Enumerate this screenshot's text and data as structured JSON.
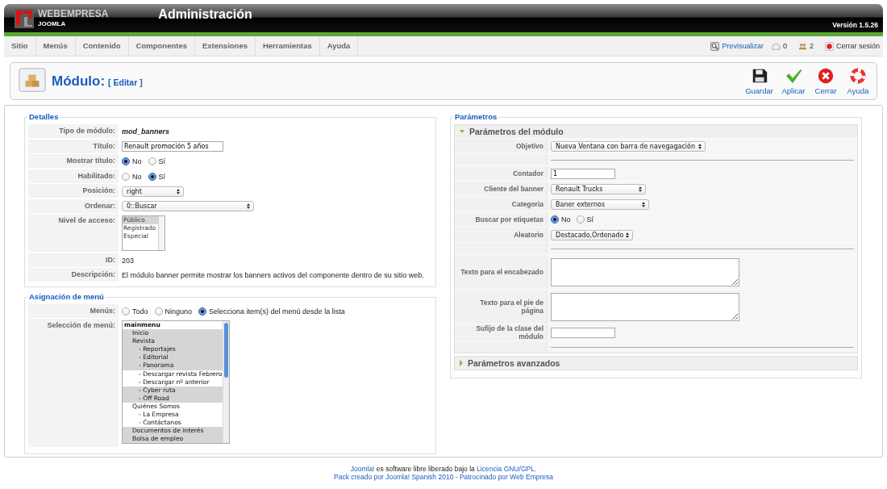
{
  "header": {
    "logo_top": "WEBEMPRESA",
    "logo_bottom": "JOOMLA",
    "title": "Administración",
    "version": "Versión 1.5.26"
  },
  "menu": [
    "Sitio",
    "Menús",
    "Contenido",
    "Componentes",
    "Extensiones",
    "Herramientas",
    "Ayuda"
  ],
  "status": {
    "preview": "Previsualizar",
    "messages": "0",
    "users": "2",
    "logout": "Cerrar sesión"
  },
  "toolbar": {
    "title": "Módulo:",
    "subtitle": "[ Editar ]",
    "buttons": [
      {
        "label": "Guardar",
        "kind": "save"
      },
      {
        "label": "Aplicar",
        "kind": "apply"
      },
      {
        "label": "Cerrar",
        "kind": "close"
      },
      {
        "label": "Ayuda",
        "kind": "help"
      }
    ]
  },
  "details": {
    "legend": "Detalles",
    "rows": [
      {
        "kind": "text",
        "label": "Tipo de módulo:",
        "value": "mod_banners",
        "emphasis": true
      },
      {
        "kind": "input",
        "label": "Título:",
        "value": "Renault promoción 5 años"
      },
      {
        "kind": "radio",
        "label": "Mostrar título:",
        "options": [
          {
            "label": "No",
            "selected": true
          },
          {
            "label": "Sí",
            "selected": false
          }
        ]
      },
      {
        "kind": "radio",
        "label": "Habilitado:",
        "options": [
          {
            "label": "No",
            "selected": false
          },
          {
            "label": "Sí",
            "selected": true
          }
        ]
      },
      {
        "kind": "select",
        "label": "Posición:",
        "value": "right"
      },
      {
        "kind": "select",
        "label": "Ordenar:",
        "value": "0::Buscar"
      },
      {
        "kind": "listbox",
        "label": "Nivel de acceso:",
        "options": [
          {
            "label": "Público",
            "selected": true
          },
          {
            "label": "Registrado",
            "selected": false
          },
          {
            "label": "Especial",
            "selected": false
          }
        ]
      },
      {
        "kind": "text",
        "label": "ID:",
        "value": "203",
        "emphasis": false
      },
      {
        "kind": "text",
        "label": "Descripción:",
        "value": "El módulo banner permite mostrar los banners activos del componente dentro de su sitio web.",
        "emphasis": false
      }
    ]
  },
  "menu_assignment": {
    "legend": "Asignación de menú",
    "menus": {
      "label": "Menús:",
      "options": [
        {
          "label": "Todo",
          "selected": false
        },
        {
          "label": "Ninguno",
          "selected": false
        },
        {
          "label": "Selecciona item(s) del menú desde la lista",
          "selected": true
        }
      ]
    },
    "selection": {
      "label": "Selección de menú:",
      "items": [
        {
          "label": "mainmenu",
          "selected": false,
          "children": [
            {
              "label": "Inicio",
              "selected": true
            },
            {
              "label": "Revista",
              "selected": true,
              "children": [
                {
                  "label": "- Reportajes",
                  "selected": true
                },
                {
                  "label": "- Editorial",
                  "selected": true
                },
                {
                  "label": "- Panorama",
                  "selected": true
                },
                {
                  "label": "- Descargar revista Febrero",
                  "selected": false
                },
                {
                  "label": "- Descargar nº anterior",
                  "selected": false
                },
                {
                  "label": "- Cyber ruta",
                  "selected": true
                },
                {
                  "label": "- Off Road",
                  "selected": true
                }
              ]
            },
            {
              "label": "Quiénes Somos",
              "selected": false,
              "children": [
                {
                  "label": "- La Empresa",
                  "selected": false
                },
                {
                  "label": "- Contáctanos",
                  "selected": false
                }
              ]
            },
            {
              "label": "Documentos de interés",
              "selected": true
            },
            {
              "label": "Bolsa de empleo",
              "selected": true
            }
          ]
        }
      ]
    }
  },
  "parameters": {
    "legend": "Parámetros",
    "panels": [
      {
        "title": "Parámetros del módulo",
        "expanded": true,
        "rows": [
          {
            "kind": "select",
            "label": "Objetivo",
            "value": "Nueva Ventana con barra de navegagación"
          },
          {
            "kind": "separator"
          },
          {
            "kind": "input",
            "label": "Contador",
            "value": "1"
          },
          {
            "kind": "select",
            "label": "Cliente del banner",
            "value": "Renault Trucks"
          },
          {
            "kind": "select",
            "label": "Categoria",
            "value": "Baner externos"
          },
          {
            "kind": "radio",
            "label": "Buscar por etiquetas",
            "options": [
              {
                "label": "No",
                "selected": true
              },
              {
                "label": "Sí",
                "selected": false
              }
            ]
          },
          {
            "kind": "select",
            "label": "Aleatorio",
            "value": "Destacado,Ordenado"
          },
          {
            "kind": "separator"
          },
          {
            "kind": "textarea",
            "label": "Texto para el encabezado"
          },
          {
            "kind": "textarea",
            "label": "Texto para el pie de página"
          },
          {
            "kind": "input",
            "label": "Sufijo de la clase del módulo",
            "value": ""
          },
          {
            "kind": "separator"
          }
        ]
      },
      {
        "title": "Parámetros avanzados",
        "expanded": false
      }
    ]
  },
  "footer": {
    "brand": "Joomla!",
    "text": "es software libre liberado bajo la",
    "license": "Licencia GNU/GPL.",
    "credit": "Pack creado por Joomla! Spanish 2010 - Patrocinado por Web Empresa"
  }
}
